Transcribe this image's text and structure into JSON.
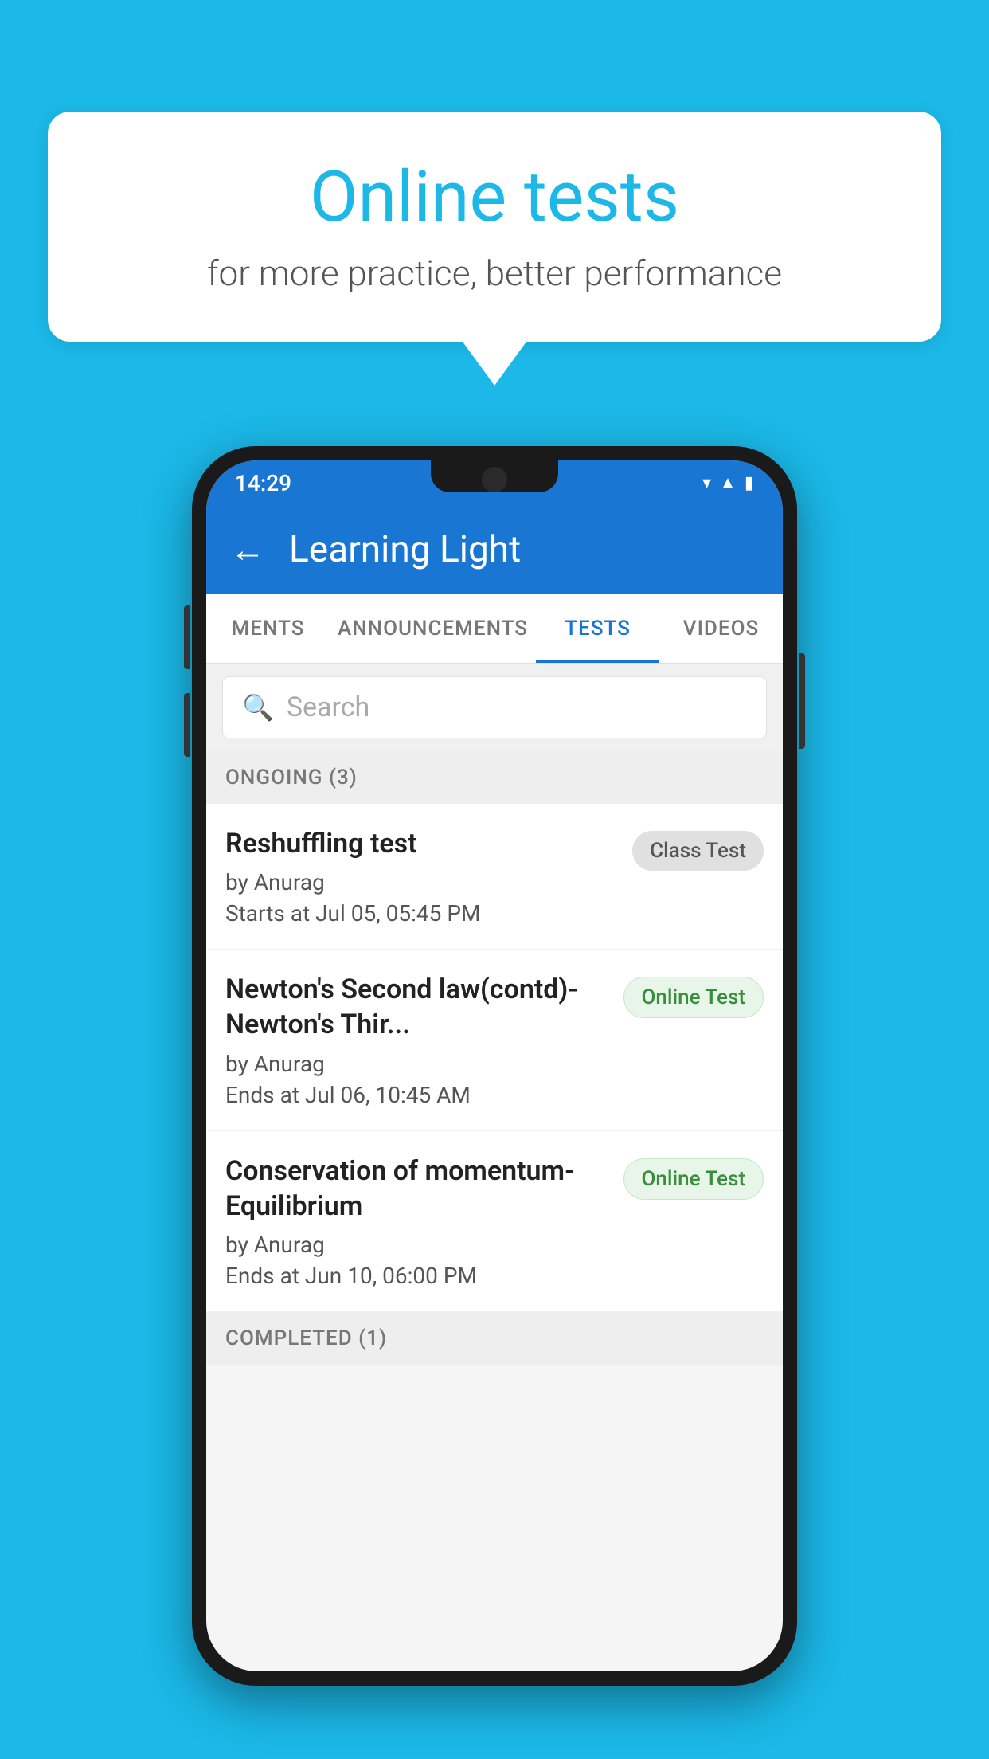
{
  "background": {
    "color": "#1BB8E8"
  },
  "speechBubble": {
    "title": "Online tests",
    "subtitle": "for more practice, better performance"
  },
  "phone": {
    "statusBar": {
      "time": "14:29",
      "icons": [
        "wifi",
        "signal",
        "battery"
      ]
    },
    "appBar": {
      "backLabel": "←",
      "title": "Learning Light"
    },
    "tabs": [
      {
        "label": "MENTS",
        "active": false
      },
      {
        "label": "ANNOUNCEMENTS",
        "active": false
      },
      {
        "label": "TESTS",
        "active": true
      },
      {
        "label": "VIDEOS",
        "active": false
      }
    ],
    "search": {
      "placeholder": "Search"
    },
    "ongoingSection": {
      "label": "ONGOING (3)"
    },
    "tests": [
      {
        "title": "Reshuffling test",
        "author": "by Anurag",
        "timeLabel": "Starts at",
        "time": "Jul 05, 05:45 PM",
        "badge": "Class Test",
        "badgeType": "class"
      },
      {
        "title": "Newton's Second law(contd)-Newton's Thir...",
        "author": "by Anurag",
        "timeLabel": "Ends at",
        "time": "Jul 06, 10:45 AM",
        "badge": "Online Test",
        "badgeType": "online"
      },
      {
        "title": "Conservation of momentum-Equilibrium",
        "author": "by Anurag",
        "timeLabel": "Ends at",
        "time": "Jun 10, 06:00 PM",
        "badge": "Online Test",
        "badgeType": "online"
      }
    ],
    "completedSection": {
      "label": "COMPLETED (1)"
    }
  }
}
